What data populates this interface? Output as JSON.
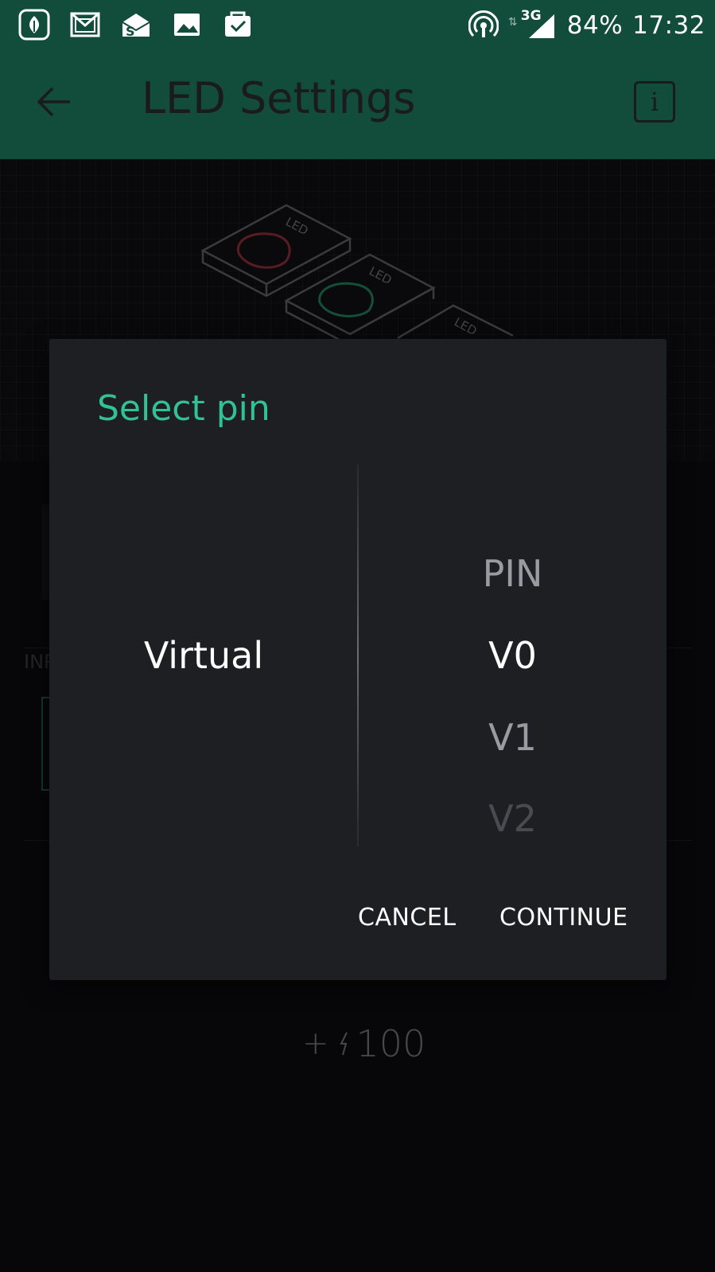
{
  "status_bar": {
    "icons": [
      "saavn-icon",
      "gmail-icon",
      "sms-organizer-icon",
      "gallery-icon",
      "tasks-icon"
    ],
    "signal_icon": "hotspot-icon",
    "network": "3G",
    "battery": "84%",
    "time": "17:32"
  },
  "app_bar": {
    "title": "LED Settings",
    "back_icon": "arrow-left-icon",
    "info_icon": "info-icon",
    "info_glyph": "i",
    "background_color": "#114d3a"
  },
  "background": {
    "hero_labels": [
      "LED",
      "LED",
      "LED"
    ],
    "input_label": "INP",
    "energy": {
      "plus": "+",
      "icon": "lightning-icon",
      "value": "100"
    }
  },
  "dialog": {
    "title": "Select pin",
    "title_color": "#30c294",
    "left_column": {
      "selected": "Virtual"
    },
    "right_column": {
      "items": [
        "PIN",
        "V0",
        "V1",
        "V2"
      ],
      "selected": "V0"
    },
    "buttons": {
      "cancel": "CANCEL",
      "continue": "CONTINUE"
    }
  }
}
